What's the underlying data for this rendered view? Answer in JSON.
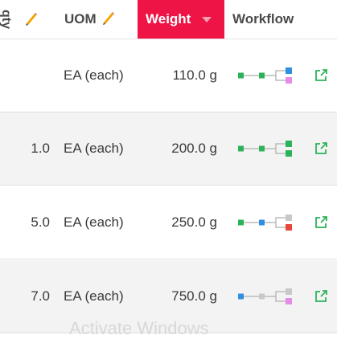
{
  "header": {
    "qty_label": "qty",
    "uom_label": "UOM",
    "weight_label": "Weight",
    "workflow_label": "Workflow"
  },
  "rows": [
    {
      "qty": "",
      "uom": "EA (each)",
      "weight": "110.0 g",
      "workflow": {
        "nodes": [
          "#2cb35a",
          "#2cb35a"
        ],
        "branch": [
          "#2f8fe0",
          "#e58be8"
        ]
      }
    },
    {
      "qty": "1.0",
      "uom": "EA (each)",
      "weight": "200.0 g",
      "workflow": {
        "nodes": [
          "#2cb35a",
          "#2cb35a"
        ],
        "branch": [
          "#2cb35a",
          "#2cb35a"
        ]
      }
    },
    {
      "qty": "5.0",
      "uom": "EA (each)",
      "weight": "250.0 g",
      "workflow": {
        "nodes": [
          "#2cb35a",
          "#2f8fe0"
        ],
        "branch": [
          "#c8c8c8",
          "#e8483a"
        ]
      }
    },
    {
      "qty": "7.0",
      "uom": "EA (each)",
      "weight": "750.0 g",
      "workflow": {
        "nodes": [
          "#2f8fe0",
          "#c8c8c8"
        ],
        "branch": [
          "#c8c8c8",
          "#e58be8"
        ]
      }
    }
  ],
  "icons": {
    "edit": "pencil-icon",
    "sort": "caret-down-icon",
    "open": "open-external-icon"
  },
  "colors": {
    "accent": "#ee1446",
    "open_icon": "#2cb35a",
    "pencil": "#f0a500"
  },
  "overlay_text": "Activate Windows"
}
